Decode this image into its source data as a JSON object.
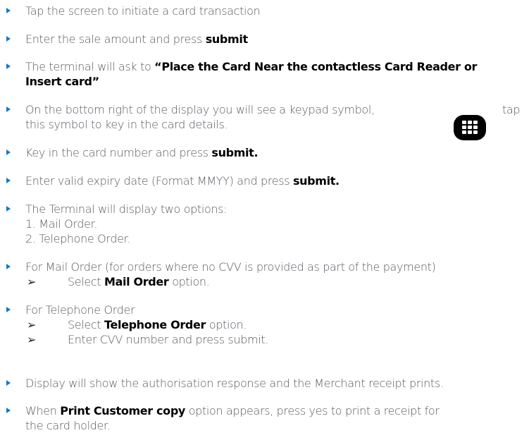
{
  "steps": [
    {
      "pre": "Tap the screen to initiate a card transaction"
    },
    {
      "pre": "Enter the sale amount and press ",
      "bold": "submit"
    },
    {
      "pre": "The terminal will ask to ",
      "bold1": "“Place the Card Near the contactless Card Reader or",
      "bold2": "Insert card”"
    },
    {
      "line1a": "On the bottom right of the display you will see a keypad symbol,",
      "line1b": "tap",
      "line2": "this symbol to key in the card details."
    },
    {
      "pre": "Key in the card number and press ",
      "bold": "submit."
    },
    {
      "pre": "Enter valid expiry date (Format MMYY) and press ",
      "bold": "submit."
    },
    {
      "line1": "The Terminal will display two options:",
      "line2": "1. Mail Order.",
      "line3": "2. Telephone Order."
    },
    {
      "line1": "For Mail Order (for orders where no CVV is provided as part of the payment)",
      "sub_pre": "Select ",
      "sub_bold": "Mail Order",
      "sub_post": " option."
    },
    {
      "line1": "For Telephone Order",
      "sub1_pre": "Select ",
      "sub1_bold": "Telephone Order",
      "sub1_post": " option.",
      "sub2": "Enter CVV number and press submit."
    },
    {
      "pre": "Display will show the authorisation response and the Merchant receipt prints."
    },
    {
      "pre": "When ",
      "bold": "Print Customer copy",
      "post": " option appears, press yes to print a receipt for",
      "line2": "the card holder."
    }
  ],
  "sub_arrow": "➢",
  "icon": "keypad-icon",
  "accent": "#1579c0"
}
